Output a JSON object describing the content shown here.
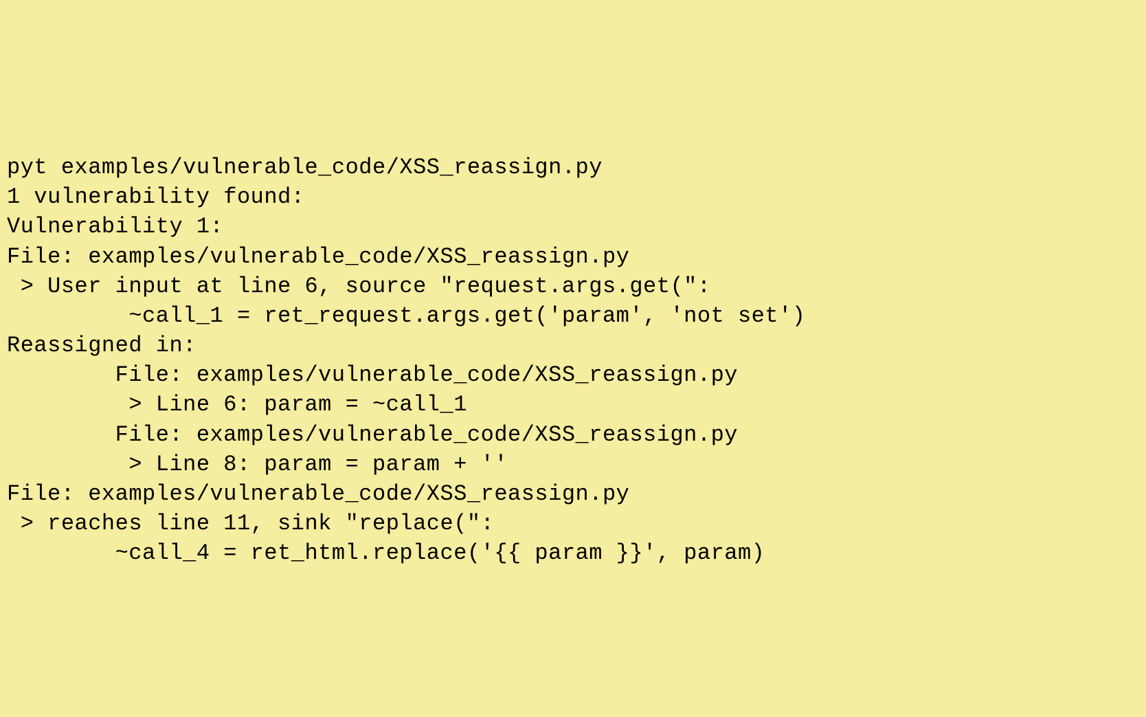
{
  "terminal": {
    "lines": [
      "pyt examples/vulnerable_code/XSS_reassign.py",
      "1 vulnerability found:",
      "Vulnerability 1:",
      "File: examples/vulnerable_code/XSS_reassign.py",
      " > User input at line 6, source \"request.args.get(\":",
      "         ~call_1 = ret_request.args.get('param', 'not set')",
      "Reassigned in:",
      "        File: examples/vulnerable_code/XSS_reassign.py",
      "         > Line 6: param = ~call_1",
      "        File: examples/vulnerable_code/XSS_reassign.py",
      "         > Line 8: param = param + ''",
      "File: examples/vulnerable_code/XSS_reassign.py",
      " > reaches line 11, sink \"replace(\":",
      "        ~call_4 = ret_html.replace('{{ param }}', param)"
    ]
  }
}
